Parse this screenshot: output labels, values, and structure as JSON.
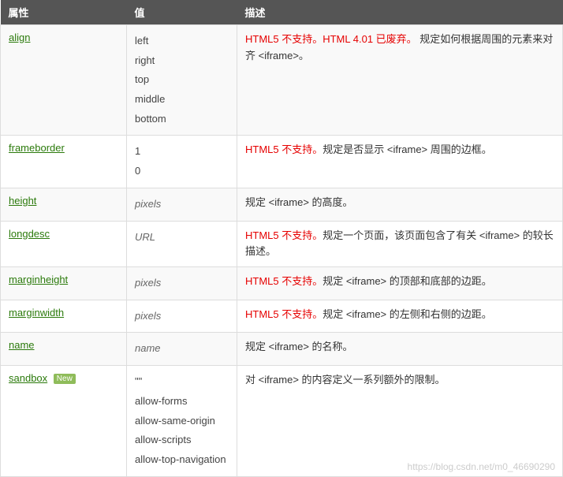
{
  "headers": {
    "attr": "属性",
    "value": "值",
    "desc": "描述"
  },
  "new_badge": "New",
  "watermark": "https://blog.csdn.net/m0_46690290",
  "rows": [
    {
      "attr": "align",
      "values": [
        "left",
        "right",
        "top",
        "middle",
        "bottom"
      ],
      "value_italic": false,
      "desc_red": "HTML5 不支持。HTML 4.01 已废弃。",
      "desc_rest": " 规定如何根据周围的元素来对齐 <iframe>。",
      "new": false
    },
    {
      "attr": "frameborder",
      "values": [
        "1",
        "0"
      ],
      "value_italic": false,
      "desc_red": "HTML5 不支持。",
      "desc_rest": "规定是否显示 <iframe> 周围的边框。",
      "new": false
    },
    {
      "attr": "height",
      "values": [
        "pixels"
      ],
      "value_italic": true,
      "desc_red": "",
      "desc_rest": "规定 <iframe> 的高度。",
      "new": false
    },
    {
      "attr": "longdesc",
      "values": [
        "URL"
      ],
      "value_italic": true,
      "desc_red": "HTML5 不支持。",
      "desc_rest": "规定一个页面，该页面包含了有关 <iframe> 的较长描述。",
      "new": false
    },
    {
      "attr": "marginheight",
      "values": [
        "pixels"
      ],
      "value_italic": true,
      "desc_red": "HTML5 不支持。",
      "desc_rest": "规定 <iframe> 的顶部和底部的边距。",
      "new": false
    },
    {
      "attr": "marginwidth",
      "values": [
        "pixels"
      ],
      "value_italic": true,
      "desc_red": "HTML5 不支持。",
      "desc_rest": "规定 <iframe> 的左侧和右侧的边距。",
      "new": false
    },
    {
      "attr": "name",
      "values": [
        "name"
      ],
      "value_italic": true,
      "desc_red": "",
      "desc_rest": "规定 <iframe> 的名称。",
      "new": false
    },
    {
      "attr": "sandbox",
      "values": [
        "\"\"",
        "allow-forms",
        "allow-same-origin",
        "allow-scripts",
        "allow-top-navigation"
      ],
      "value_italic": false,
      "desc_red": "",
      "desc_rest": "对 <iframe> 的内容定义一系列额外的限制。",
      "new": true
    }
  ]
}
